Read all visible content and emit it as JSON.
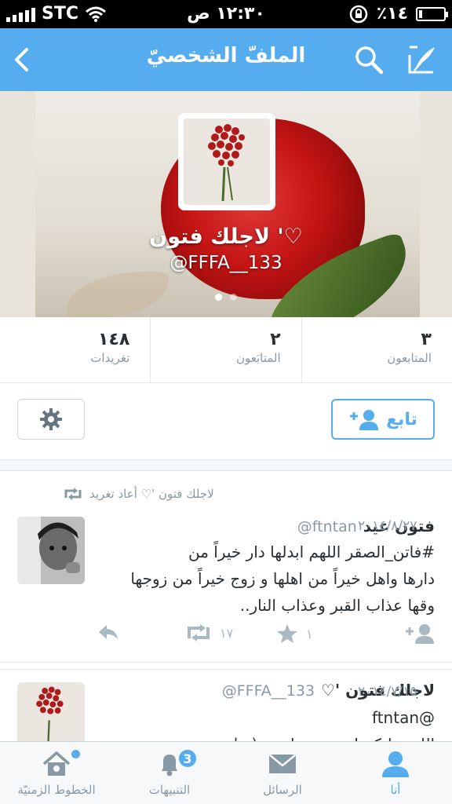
{
  "status_bar": {
    "carrier": "STC",
    "time": "١٢:٣٠ ص",
    "battery_percent": "٪١٤",
    "battery_level": 0.14
  },
  "nav": {
    "title": "الملفّ الشخصيّ",
    "back_icon": "chevron-left-icon",
    "search_icon": "search-icon",
    "compose_icon": "compose-icon"
  },
  "profile": {
    "name": "لاجلك فتون '♡",
    "handle": "@FFFA__133"
  },
  "stats": [
    {
      "value": "١٤٨",
      "label": "تغريدات"
    },
    {
      "value": "٢",
      "label": "المتابَعون"
    },
    {
      "value": "٣",
      "label": "المتابعون"
    }
  ],
  "actions": {
    "follow_label": "تابع",
    "settings_icon": "gear-icon"
  },
  "tweets": [
    {
      "retweet_note": "لاجلك فتون '♡ أعاد تغريد",
      "name": "فتون عيد",
      "handle": "@ftntan",
      "date": "٢٠١٤/٨/٢٧",
      "text": "#فاتن_الصقر اللهم ابدلها دار خيراً من\nدارها واهل خيراً من اهلها و زوج خيراً من زوجها\nوقها عذاب القبر وعذاب النار..",
      "retweets": "١٧",
      "favorites": "١"
    },
    {
      "name": "لاجلك فتون '♡",
      "handle": "@FFFA__133",
      "date": "٢٠١٤/٧/١٥",
      "text": "@ftntan\nالله يخليكم لي بعض يارب :(=|"
    }
  ],
  "tabbar": [
    {
      "label": "الخطوط الزمنيّة",
      "icon": "home-icon"
    },
    {
      "label": "التنبيهات",
      "icon": "bell-icon",
      "badge": "3"
    },
    {
      "label": "الرسائل",
      "icon": "envelope-icon"
    },
    {
      "label": "أنا",
      "icon": "person-icon"
    }
  ],
  "colors": {
    "accent": "#55acee",
    "text": "#292f33",
    "muted": "#8899a6"
  }
}
